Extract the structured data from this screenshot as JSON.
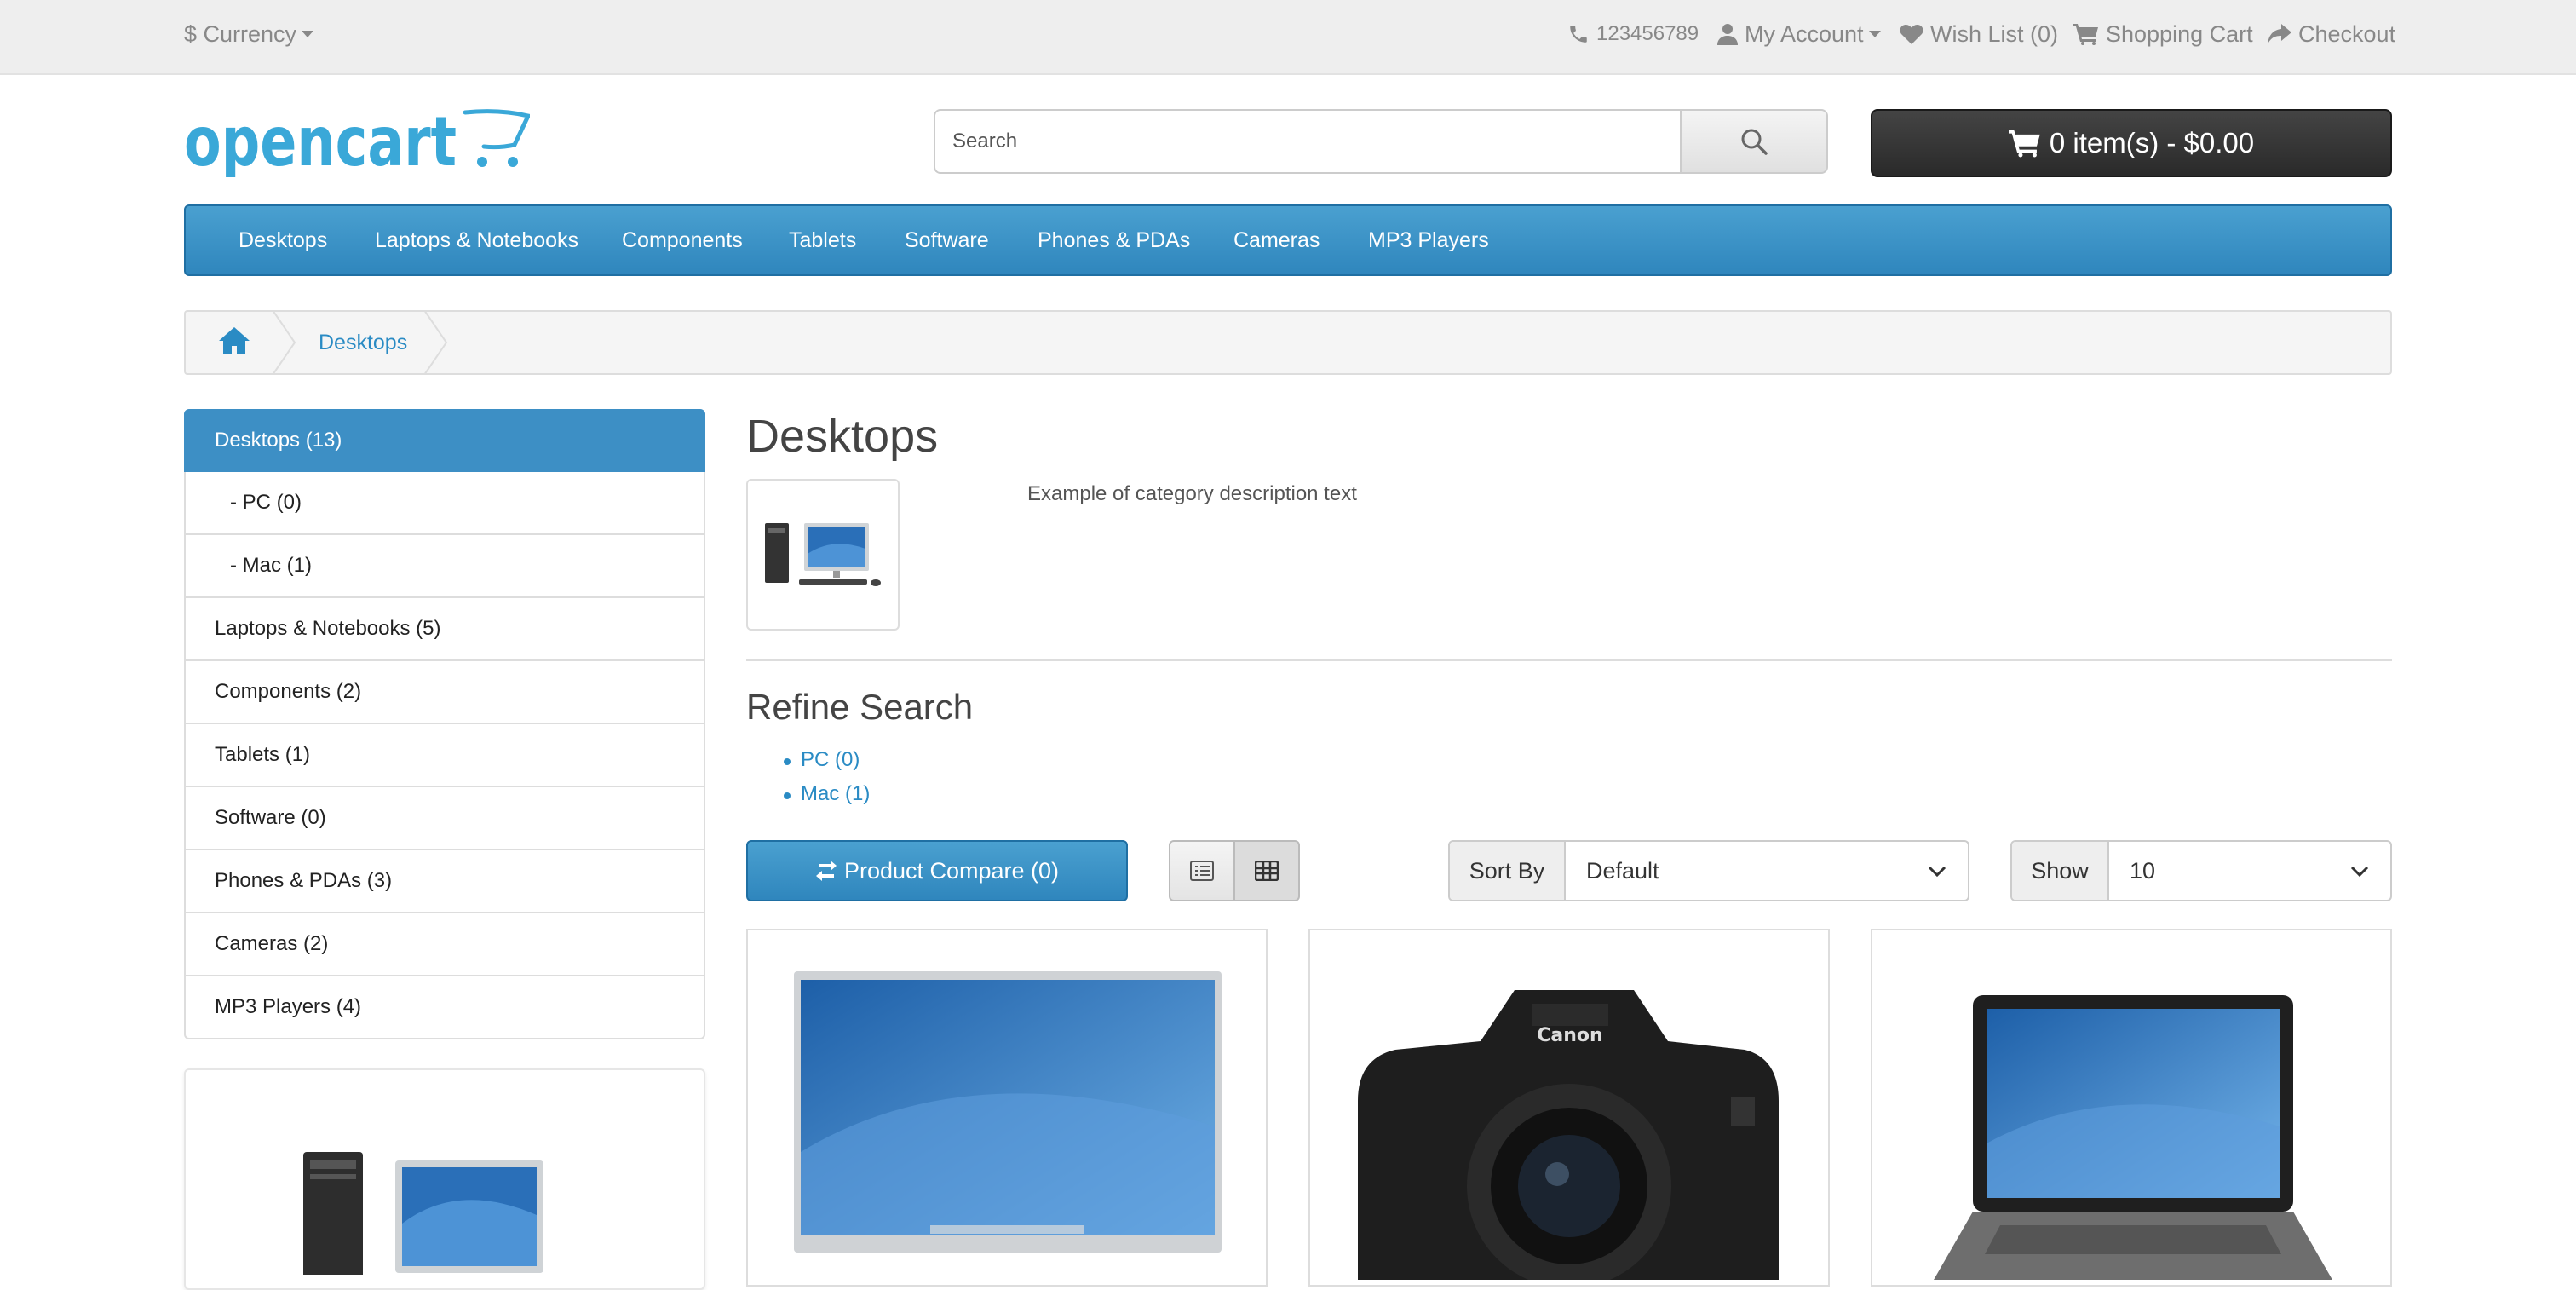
{
  "topbar": {
    "currency_label": "$ Currency",
    "phone": "123456789",
    "my_account": "My Account",
    "wishlist": "Wish List (0)",
    "shopping_cart": "Shopping Cart",
    "checkout": "Checkout"
  },
  "header": {
    "logo_text": "opencart",
    "search_placeholder": "Search",
    "cart_button": "0 item(s) - $0.00"
  },
  "menu": {
    "items": [
      "Desktops",
      "Laptops & Notebooks",
      "Components",
      "Tablets",
      "Software",
      "Phones & PDAs",
      "Cameras",
      "MP3 Players"
    ]
  },
  "breadcrumb": {
    "current": "Desktops"
  },
  "sidebar": {
    "categories": [
      {
        "label": "Desktops (13)"
      },
      {
        "label": "- PC (0)"
      },
      {
        "label": "- Mac (1)"
      },
      {
        "label": "Laptops & Notebooks (5)"
      },
      {
        "label": "Components (2)"
      },
      {
        "label": "Tablets (1)"
      },
      {
        "label": "Software (0)"
      },
      {
        "label": "Phones & PDAs (3)"
      },
      {
        "label": "Cameras (2)"
      },
      {
        "label": "MP3 Players (4)"
      }
    ]
  },
  "main": {
    "title": "Desktops",
    "description": "Example of category description text",
    "refine_title": "Refine Search",
    "refine_links": [
      "PC (0)",
      "Mac (1)"
    ],
    "compare_button": "Product Compare (0)",
    "sort_label": "Sort By",
    "sort_value": "Default",
    "show_label": "Show",
    "show_value": "10"
  },
  "colors": {
    "accent": "#3d8fc5",
    "link": "#2a8bc4",
    "cart_button": "#333333"
  },
  "icons": [
    "phone-icon",
    "user-icon",
    "heart-icon",
    "cart-icon",
    "share-icon",
    "search-icon",
    "home-icon",
    "exchange-icon",
    "list-icon",
    "grid-icon",
    "chevron-down-icon"
  ]
}
